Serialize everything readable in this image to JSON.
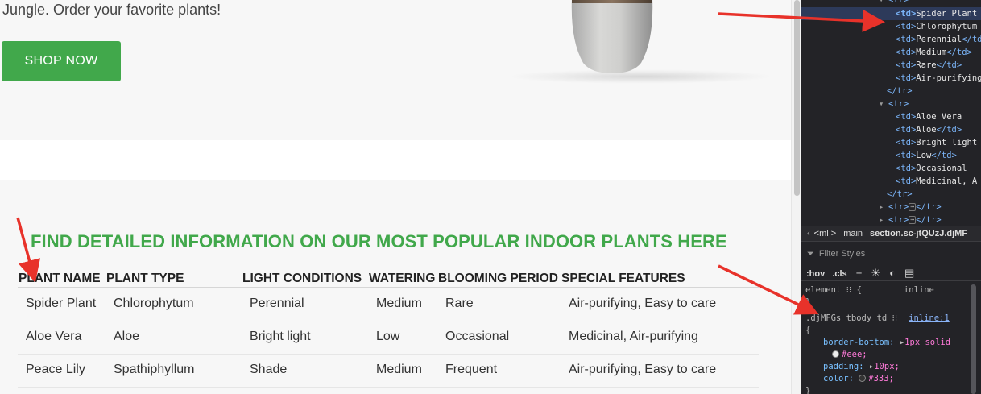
{
  "hero": {
    "tagline": "Jungle. Order your favorite plants!",
    "shop_button": "SHOP NOW"
  },
  "section": {
    "title": "FIND DETAILED INFORMATION ON OUR MOST POPULAR INDOOR PLANTS HERE"
  },
  "table": {
    "headers": [
      "PLANT NAME",
      "PLANT TYPE",
      "LIGHT CONDITIONS",
      "WATERING",
      "BLOOMING PERIOD",
      "SPECIAL FEATURES"
    ],
    "rows": [
      [
        "Spider Plant",
        "Chlorophytum",
        "Perennial",
        "Medium",
        "Rare",
        "Air-purifying, Easy to care"
      ],
      [
        "Aloe Vera",
        "Aloe",
        "Bright light",
        "Low",
        "Occasional",
        "Medicinal, Air-purifying"
      ],
      [
        "Peace Lily",
        "Spathiphyllum",
        "Shade",
        "Medium",
        "Frequent",
        "Air-purifying, Easy to care"
      ]
    ]
  },
  "devtools": {
    "dom": {
      "tr_open": "<tr>",
      "tr_close": "</tr>",
      "row1": [
        "Spider Plant",
        "Chlorophytum",
        "Perennial",
        "Medium",
        "Rare",
        "Air-purifying"
      ],
      "row2": [
        "Aloe Vera",
        "Aloe",
        "Bright light",
        "Low",
        "Occasional",
        "Medicinal, A"
      ],
      "td_open": "<td>",
      "td_close": "</td>",
      "collapsed_open": "<tr>",
      "collapsed_close": "</tr>",
      "ellipsis": "⋯"
    },
    "breadcrumbs": {
      "item1": "<ml >",
      "item2": "main",
      "item3": "section.sc-jtQUzJ.djMF"
    },
    "styles": {
      "filter_placeholder": "Filter Styles",
      "hov": ":hov",
      "cls": ".cls",
      "element_rule": "element",
      "element_brace_open": "{",
      "element_brace_close": "}",
      "element_source": "inline",
      "selector": ".djMFGs tbody td",
      "selector_source": "inline:1",
      "brace_open": "{",
      "brace_close": "}",
      "prop1_name": "border-bottom:",
      "prop1_value": "1px solid",
      "prop1_value2": "#eee;",
      "prop2_name": "padding:",
      "prop2_value": "10px;",
      "prop3_name": "color:",
      "prop3_value": "#333;"
    }
  },
  "colors": {
    "brand_green": "#41a84b",
    "arrow_red": "#e8322a",
    "devtools_bg": "#232327"
  }
}
